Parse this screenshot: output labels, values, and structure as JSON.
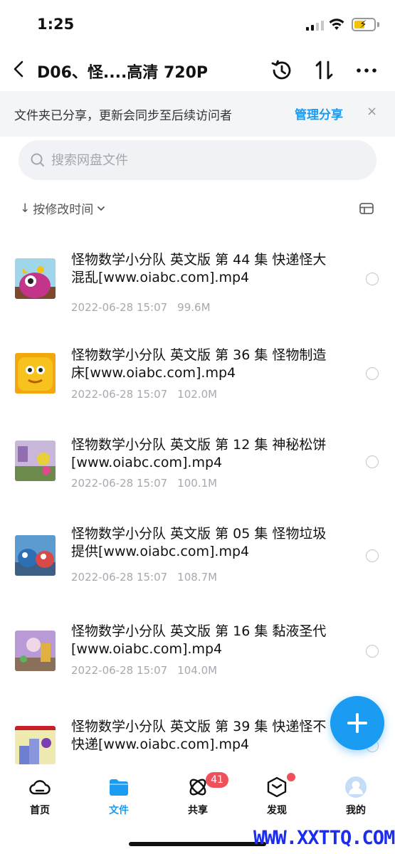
{
  "status": {
    "time": "1:25"
  },
  "header": {
    "title": "D06、怪....高清 720P",
    "back_icon": "chevron-left-icon",
    "actions": [
      "history-icon",
      "transfer-icon",
      "more-icon"
    ]
  },
  "banner": {
    "text": "文件夹已分享，更新会同步至后续访问者",
    "manage_label": "管理分享",
    "close_label": "×"
  },
  "search": {
    "placeholder": "搜索网盘文件",
    "value": ""
  },
  "sort": {
    "arrow": "↓",
    "label": "按修改时间",
    "chevron": "⌄"
  },
  "files": [
    {
      "name": "怪物数学小分队 英文版 第 44 集 快递怪大混乱[www.oiabc.com].mp4",
      "date": "2022-06-28 15:07",
      "size": "99.6M"
    },
    {
      "name": "怪物数学小分队 英文版 第 36 集 怪物制造床[www.oiabc.com].mp4",
      "date": "2022-06-28 15:07",
      "size": "102.0M"
    },
    {
      "name": "怪物数学小分队 英文版 第 12 集 神秘松饼[www.oiabc.com].mp4",
      "date": "2022-06-28 15:07",
      "size": "100.1M"
    },
    {
      "name": "怪物数学小分队 英文版 第 05 集 怪物垃圾提供[www.oiabc.com].mp4",
      "date": "2022-06-28 15:07",
      "size": "108.7M"
    },
    {
      "name": "怪物数学小分队 英文版 第 16 集 黏液圣代[www.oiabc.com].mp4",
      "date": "2022-06-28 15:07",
      "size": "104.0M"
    },
    {
      "name": "怪物数学小分队 英文版 第 39 集 快递怪不快递[www.oiabc.com].mp4",
      "date": "",
      "size": ""
    }
  ],
  "nav": {
    "home": "首页",
    "files": "文件",
    "share": "共享",
    "discover": "发现",
    "me": "我的",
    "share_badge": "41"
  },
  "watermark": "WWW.XXTTQ.COM",
  "colors": {
    "accent": "#1a9cf3",
    "badge": "#f0505a"
  }
}
